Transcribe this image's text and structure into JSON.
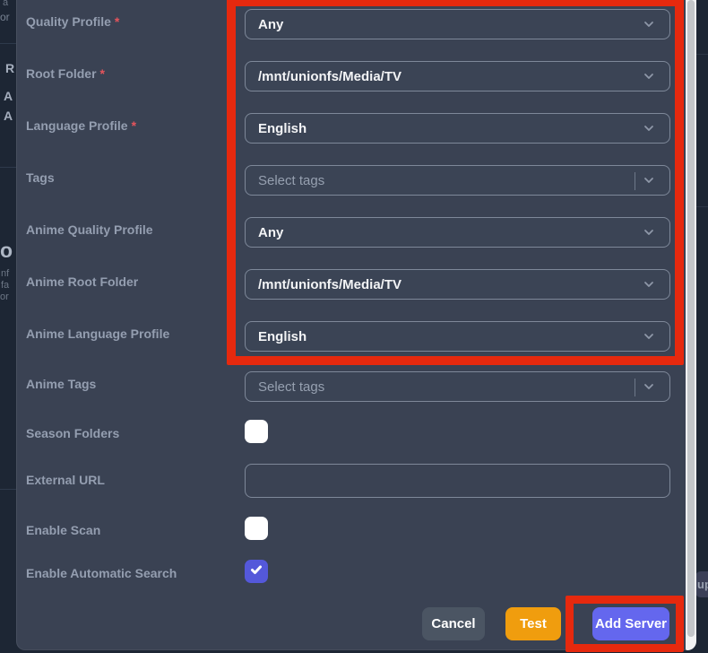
{
  "form": {
    "required_marker": "*",
    "rows": [
      {
        "label": "Quality Profile",
        "required": true,
        "type": "select",
        "value": "Any"
      },
      {
        "label": "Root Folder",
        "required": true,
        "type": "select",
        "value": "/mnt/unionfs/Media/TV"
      },
      {
        "label": "Language Profile",
        "required": true,
        "type": "select",
        "value": "English"
      },
      {
        "label": "Tags",
        "required": false,
        "type": "multiselect",
        "placeholder": "Select tags"
      },
      {
        "label": "Anime Quality Profile",
        "required": false,
        "type": "select",
        "value": "Any"
      },
      {
        "label": "Anime Root Folder",
        "required": false,
        "type": "select",
        "value": "/mnt/unionfs/Media/TV"
      },
      {
        "label": "Anime Language Profile",
        "required": false,
        "type": "select",
        "value": "English"
      },
      {
        "label": "Anime Tags",
        "required": false,
        "type": "multiselect",
        "placeholder": "Select tags"
      },
      {
        "label": "Season Folders",
        "required": false,
        "type": "checkbox",
        "checked": false
      },
      {
        "label": "External URL",
        "required": false,
        "type": "text",
        "value": ""
      },
      {
        "label": "Enable Scan",
        "required": false,
        "type": "checkbox",
        "checked": false
      },
      {
        "label": "Enable Automatic Search",
        "required": false,
        "type": "checkbox",
        "checked": true
      }
    ]
  },
  "buttons": {
    "cancel": "Cancel",
    "test": "Test",
    "add_server": "Add Server"
  },
  "background": {
    "left_fragments": [
      {
        "text": "a"
      },
      {
        "text": "or"
      },
      {
        "text": "R"
      },
      {
        "text": "A"
      },
      {
        "text": "A"
      },
      {
        "text": "o"
      },
      {
        "text": "nf"
      },
      {
        "text": "fa"
      },
      {
        "text": "or"
      }
    ],
    "right_fragment": "up"
  },
  "colors": {
    "page_background": "#1d2634",
    "modal_background": "#3a4253",
    "field_border": "#7e8899",
    "label_text": "#949eb0",
    "value_text": "#f3f4f6",
    "placeholder_text": "#96a0b0",
    "required_asterisk": "#e5545c",
    "annotation_red": "#e6290e",
    "cancel_button": "#4b5563",
    "test_button": "#f09d0e",
    "add_server_button": "#6467ee",
    "checkbox_checked": "#5458da"
  },
  "annotations": {
    "form_box": "highlight around profile/folder dropdowns",
    "add_server_box": "highlight around Add Server button"
  }
}
